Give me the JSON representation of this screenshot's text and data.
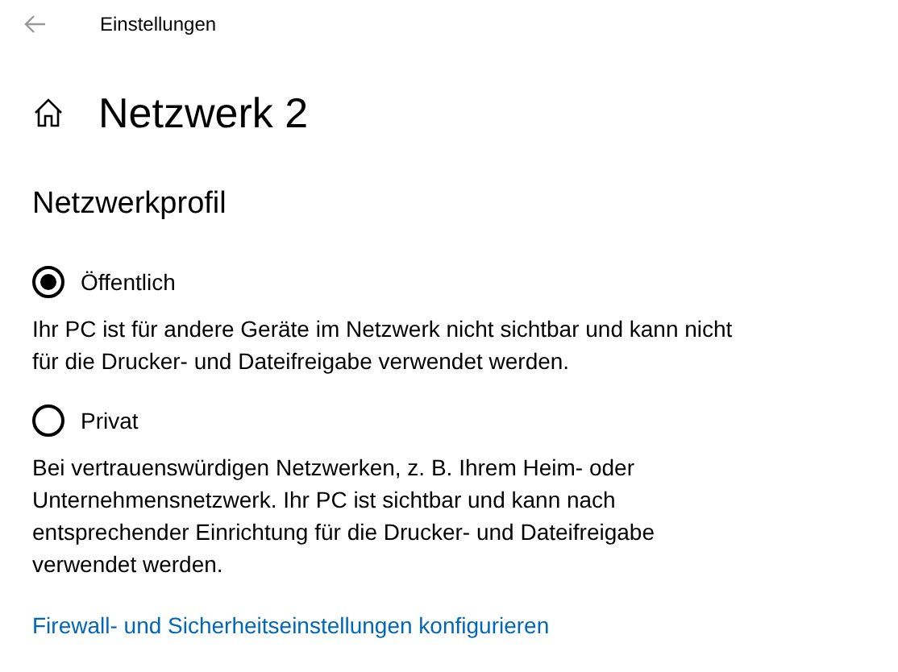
{
  "header": {
    "title": "Einstellungen"
  },
  "page": {
    "title": "Netzwerk 2"
  },
  "section": {
    "title": "Netzwerkprofil"
  },
  "options": [
    {
      "label": "Öffentlich",
      "selected": true,
      "description": "Ihr PC ist für andere Geräte im Netzwerk nicht sichtbar und kann nicht für die Drucker- und Dateifreigabe verwendet werden."
    },
    {
      "label": "Privat",
      "selected": false,
      "description": "Bei vertrauenswürdigen Netzwerken, z. B. Ihrem Heim- oder Unternehmensnetzwerk. Ihr PC ist sichtbar und kann nach entsprechender Einrichtung für die Drucker- und Dateifreigabe verwendet werden."
    }
  ],
  "link": "Firewall- und Sicherheitseinstellungen konfigurieren"
}
